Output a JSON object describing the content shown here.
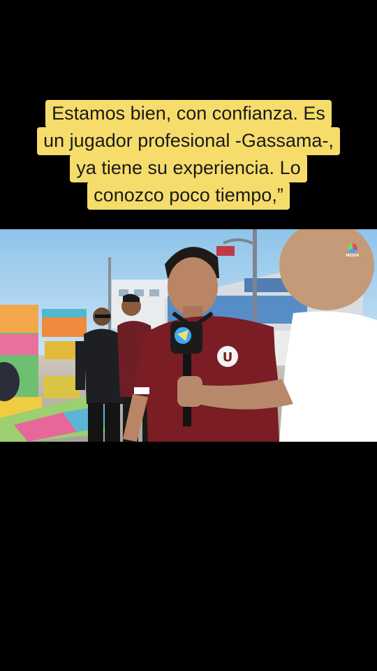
{
  "caption": {
    "lines": [
      "Estamos bien, con confianza. Es",
      "un jugador profesional -Gassama-,",
      "ya tiene su experiencia. Lo",
      "conozco poco tiempo,”"
    ]
  },
  "video": {
    "shirt_badge": "U",
    "watermark_text": "MEDIA",
    "colors": {
      "caption_bg": "#f6dc6b",
      "jersey": "#7a1d24",
      "sky": "#a9d4ef"
    }
  }
}
